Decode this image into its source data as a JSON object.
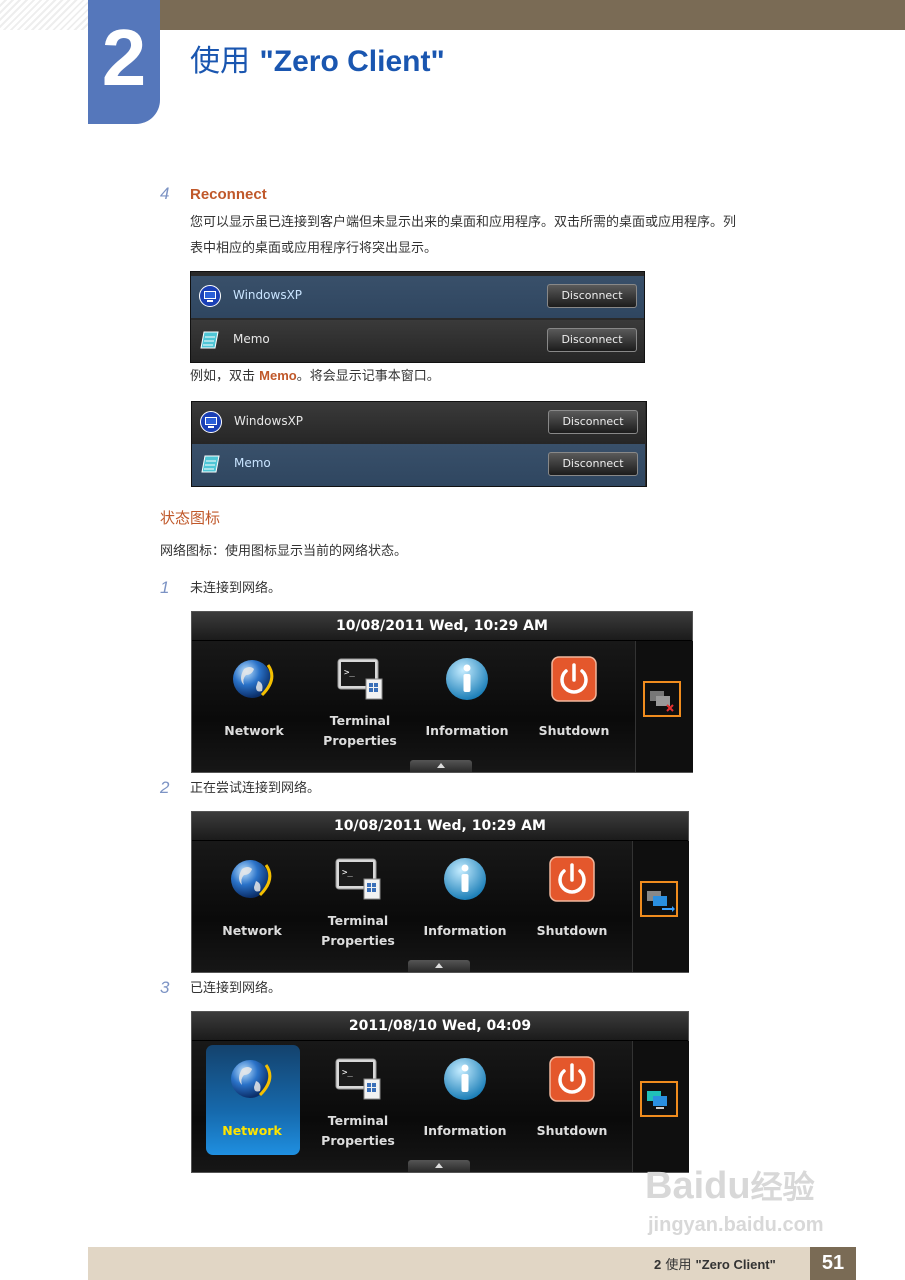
{
  "header": {
    "chapter_number": "2",
    "chapter_title_prefix": "使用",
    "chapter_title_product": "\"Zero Client\""
  },
  "reconnect": {
    "step": "4",
    "title": "Reconnect",
    "description_line1": "您可以显示虽已连接到客户端但未显示出来的桌面和应用程序。双击所需的桌面或应用程序。列",
    "description_line2": "表中相应的桌面或应用程序行将突出显示。",
    "example_prefix": "例如，双击 ",
    "example_highlight": "Memo",
    "example_suffix": "。将会显示记事本窗口。",
    "sessions": [
      {
        "name": "WindowsXP",
        "button": "Disconnect"
      },
      {
        "name": "Memo",
        "button": "Disconnect"
      }
    ]
  },
  "status_icons": {
    "title": "状态图标",
    "description": "网络图标：使用图标显示当前的网络状态。",
    "items": [
      {
        "step": "1",
        "text": "未连接到网络。",
        "datetime": "10/08/2011 Wed, 10:29 AM"
      },
      {
        "step": "2",
        "text": "正在尝试连接到网络。",
        "datetime": "10/08/2011 Wed, 10:29 AM"
      },
      {
        "step": "3",
        "text": "已连接到网络。",
        "datetime": "2011/08/10 Wed, 04:09"
      }
    ],
    "menu": {
      "network": "Network",
      "terminal_line1": "Terminal",
      "terminal_line2": "Properties",
      "information": "Information",
      "shutdown": "Shutdown"
    }
  },
  "footer": {
    "chapter_number": "2",
    "label_prefix": "使用",
    "label_product": "\"Zero Client\"",
    "page_number": "51"
  },
  "watermark": {
    "brand": "Bai",
    "brand_du": "du",
    "brand_cn": "经验",
    "url": "jingyan.baidu.com"
  },
  "colors": {
    "accent_blue": "#1a56b0",
    "section_orange": "#c0582a",
    "header_brown": "#7a6b55",
    "status_orange": "#f08c1e"
  }
}
